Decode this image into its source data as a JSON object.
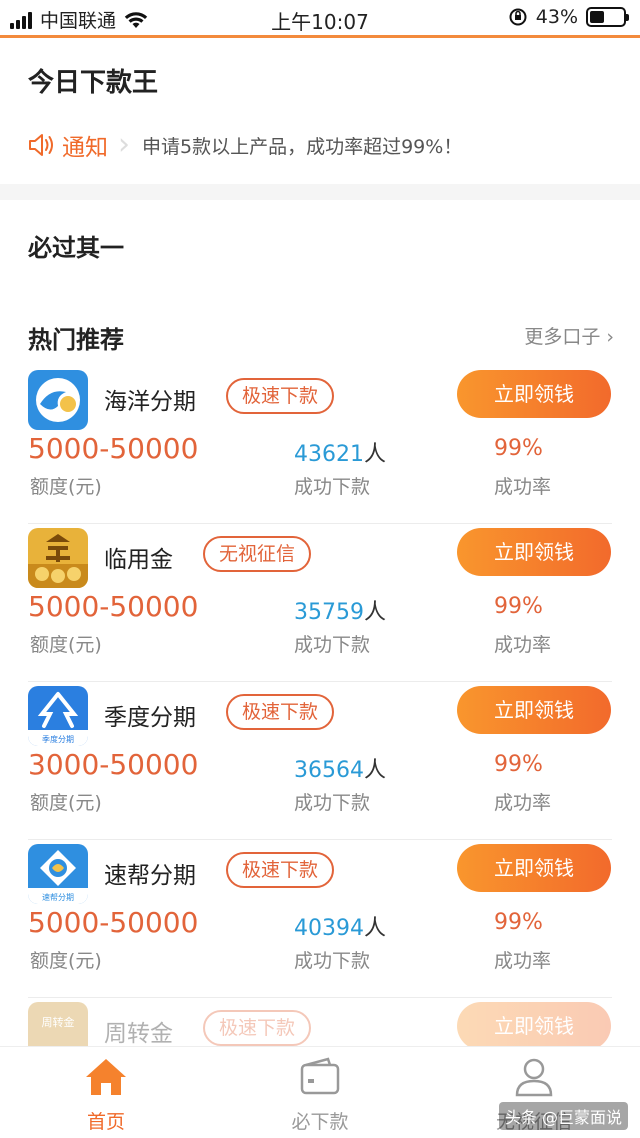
{
  "status_bar": {
    "carrier": "中国联通",
    "time": "上午10:07",
    "battery": "43%"
  },
  "header": {
    "title": "今日下款王"
  },
  "notice": {
    "label": "通知",
    "text": "申请5款以上产品，成功率超过99%！"
  },
  "sections": {
    "must_pass": "必过其一",
    "hot": "热门推荐",
    "more": "更多口子 ›"
  },
  "products": [
    {
      "name": "海洋分期",
      "tag": "极速下款",
      "cta": "立即领钱",
      "amount": "5000-50000",
      "amount_label": "额度(元)",
      "count": "43621",
      "unit": "人",
      "count_label": "成功下款",
      "rate": "99%",
      "rate_label": "成功率",
      "logo_icon": "ocean-wave-icon"
    },
    {
      "name": "临用金",
      "tag": "无视征信",
      "cta": "立即领钱",
      "amount": "5000-50000",
      "amount_label": "额度(元)",
      "count": "35759",
      "unit": "人",
      "count_label": "成功下款",
      "rate": "99%",
      "rate_label": "成功率",
      "logo_icon": "gold-coin-icon"
    },
    {
      "name": "季度分期",
      "tag": "极速下款",
      "cta": "立即领钱",
      "amount": "3000-50000",
      "amount_label": "额度(元)",
      "count": "36564",
      "unit": "人",
      "count_label": "成功下款",
      "rate": "99%",
      "rate_label": "成功率",
      "logo_icon": "quarter-logo-icon",
      "logo_text": "季度分期"
    },
    {
      "name": "速帮分期",
      "tag": "极速下款",
      "cta": "立即领钱",
      "amount": "5000-50000",
      "amount_label": "额度(元)",
      "count": "40394",
      "unit": "人",
      "count_label": "成功下款",
      "rate": "99%",
      "rate_label": "成功率",
      "logo_icon": "subang-logo-icon",
      "logo_text": "速帮分期"
    },
    {
      "name": "周转金",
      "tag": "极速下款",
      "cta": "立即领钱",
      "logo_icon": "zhouzhuan-logo-icon",
      "logo_text": "周转金"
    }
  ],
  "tabs": [
    {
      "label": "首页",
      "icon": "home-icon",
      "active": true
    },
    {
      "label": "必下款",
      "icon": "wallet-icon",
      "active": false
    },
    {
      "label": "无视征信",
      "icon": "user-icon",
      "active": false
    }
  ],
  "watermark": "头条 @巨蒙面说",
  "colors": {
    "accent": "#f06a2a",
    "blue_count": "#2a9ad6",
    "button_gradient_start": "#f9962d",
    "button_gradient_end": "#f26a2c"
  }
}
